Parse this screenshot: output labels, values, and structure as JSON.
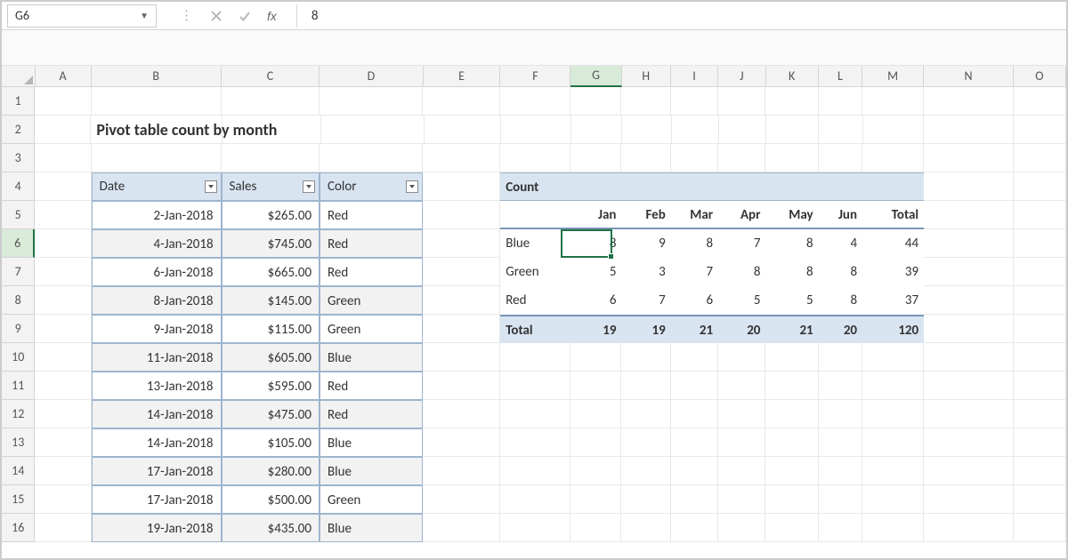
{
  "nameBox": "G6",
  "formulaBar": {
    "value": "8",
    "fx_label": "fx"
  },
  "columns": [
    "A",
    "B",
    "C",
    "D",
    "E",
    "F",
    "G",
    "H",
    "I",
    "J",
    "K",
    "L",
    "M",
    "N",
    "O"
  ],
  "activeCol": "G",
  "activeRow": 6,
  "title": "Pivot table count by month",
  "table": {
    "headers": {
      "date": "Date",
      "sales": "Sales",
      "color": "Color"
    },
    "rows": [
      {
        "date": "2-Jan-2018",
        "sales": "$265.00",
        "color": "Red"
      },
      {
        "date": "4-Jan-2018",
        "sales": "$745.00",
        "color": "Red"
      },
      {
        "date": "6-Jan-2018",
        "sales": "$665.00",
        "color": "Red"
      },
      {
        "date": "8-Jan-2018",
        "sales": "$145.00",
        "color": "Green"
      },
      {
        "date": "9-Jan-2018",
        "sales": "$115.00",
        "color": "Green"
      },
      {
        "date": "11-Jan-2018",
        "sales": "$605.00",
        "color": "Blue"
      },
      {
        "date": "13-Jan-2018",
        "sales": "$595.00",
        "color": "Red"
      },
      {
        "date": "14-Jan-2018",
        "sales": "$475.00",
        "color": "Red"
      },
      {
        "date": "14-Jan-2018",
        "sales": "$105.00",
        "color": "Blue"
      },
      {
        "date": "17-Jan-2018",
        "sales": "$280.00",
        "color": "Blue"
      },
      {
        "date": "17-Jan-2018",
        "sales": "$500.00",
        "color": "Green"
      },
      {
        "date": "19-Jan-2018",
        "sales": "$435.00",
        "color": "Blue"
      }
    ]
  },
  "pivot": {
    "title": "Count",
    "cols": [
      "Jan",
      "Feb",
      "Mar",
      "Apr",
      "May",
      "Jun",
      "Total"
    ],
    "rows": [
      {
        "label": "Blue",
        "vals": [
          "8",
          "9",
          "8",
          "7",
          "8",
          "4",
          "44"
        ]
      },
      {
        "label": "Green",
        "vals": [
          "5",
          "3",
          "7",
          "8",
          "8",
          "8",
          "39"
        ]
      },
      {
        "label": "Red",
        "vals": [
          "6",
          "7",
          "6",
          "5",
          "5",
          "8",
          "37"
        ]
      }
    ],
    "totalLabel": "Total",
    "totals": [
      "19",
      "19",
      "21",
      "20",
      "21",
      "20",
      "120"
    ]
  },
  "chart_data": {
    "type": "table",
    "title": "Count",
    "categories": [
      "Jan",
      "Feb",
      "Mar",
      "Apr",
      "May",
      "Jun"
    ],
    "series": [
      {
        "name": "Blue",
        "values": [
          8,
          9,
          8,
          7,
          8,
          4
        ]
      },
      {
        "name": "Green",
        "values": [
          5,
          3,
          7,
          8,
          8,
          8
        ]
      },
      {
        "name": "Red",
        "values": [
          6,
          7,
          6,
          5,
          5,
          8
        ]
      }
    ],
    "row_totals": {
      "Blue": 44,
      "Green": 39,
      "Red": 37
    },
    "col_totals": [
      19,
      19,
      21,
      20,
      21,
      20
    ],
    "grand_total": 120
  }
}
